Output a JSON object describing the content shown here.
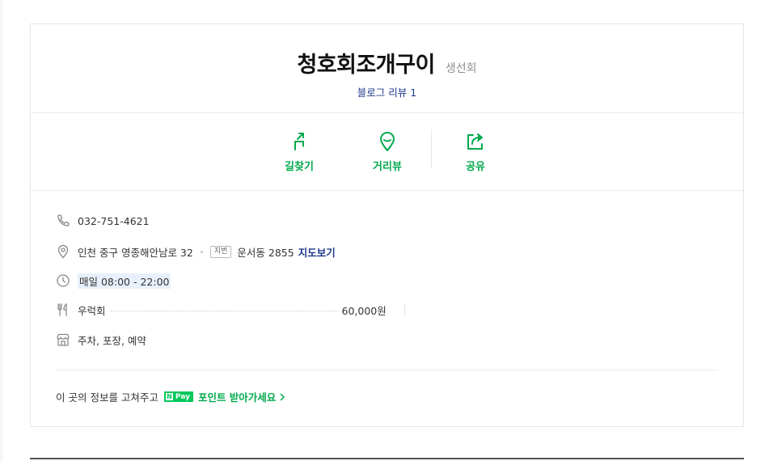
{
  "place": {
    "name": "청호회조개구이",
    "category": "생선회",
    "review_label": "블로그 리뷰",
    "review_count": "1"
  },
  "actions": [
    {
      "label": "길찾기",
      "icon": "directions-icon"
    },
    {
      "label": "거리뷰",
      "icon": "location-pin-icon"
    },
    {
      "label": "공유",
      "icon": "share-icon"
    }
  ],
  "info": {
    "phone": "032-751-4621",
    "address": "인천 중구 영종해안남로 32",
    "jibun_badge": "지번",
    "jibun_address": "운서동 2855",
    "map_link": "지도보기",
    "hours": "매일 08:00 - 22:00",
    "menu_name": "우럭회",
    "menu_price": "60,000원",
    "services": "주차, 포장, 예약"
  },
  "footer": {
    "prompt": "이 곳의 정보를 고쳐주고",
    "npay_n": "N",
    "npay_label": "Pay",
    "point_link": "포인트 받아가세요"
  },
  "colors": {
    "accent_green": "#03a94d",
    "link_blue": "#1f3a8a",
    "npay_green": "#03c75a"
  }
}
